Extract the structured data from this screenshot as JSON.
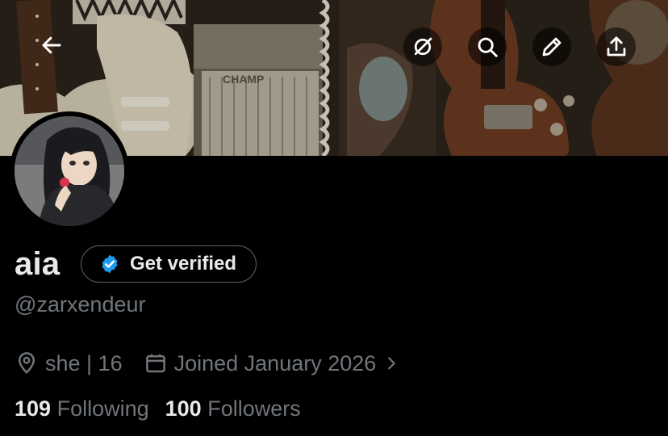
{
  "header": {
    "back_icon": "arrow-left-icon",
    "actions": [
      {
        "icon": "grok-icon"
      },
      {
        "icon": "search-icon"
      },
      {
        "icon": "edit-pencil-icon"
      },
      {
        "icon": "share-icon"
      }
    ]
  },
  "banner": {
    "amp_label": "CHAMP"
  },
  "profile": {
    "name": "aia",
    "verify_label": "Get verified",
    "handle": "@zarxendeur",
    "bio_meta": "she | 16",
    "joined": "Joined January 2026",
    "following_count": "109",
    "following_label": "Following",
    "followers_count": "100",
    "followers_label": "Followers"
  },
  "colors": {
    "background": "#000000",
    "text_primary": "#e7e9ea",
    "text_secondary": "#71767b",
    "verified_blue": "#1d9bf0",
    "border": "#536471"
  }
}
